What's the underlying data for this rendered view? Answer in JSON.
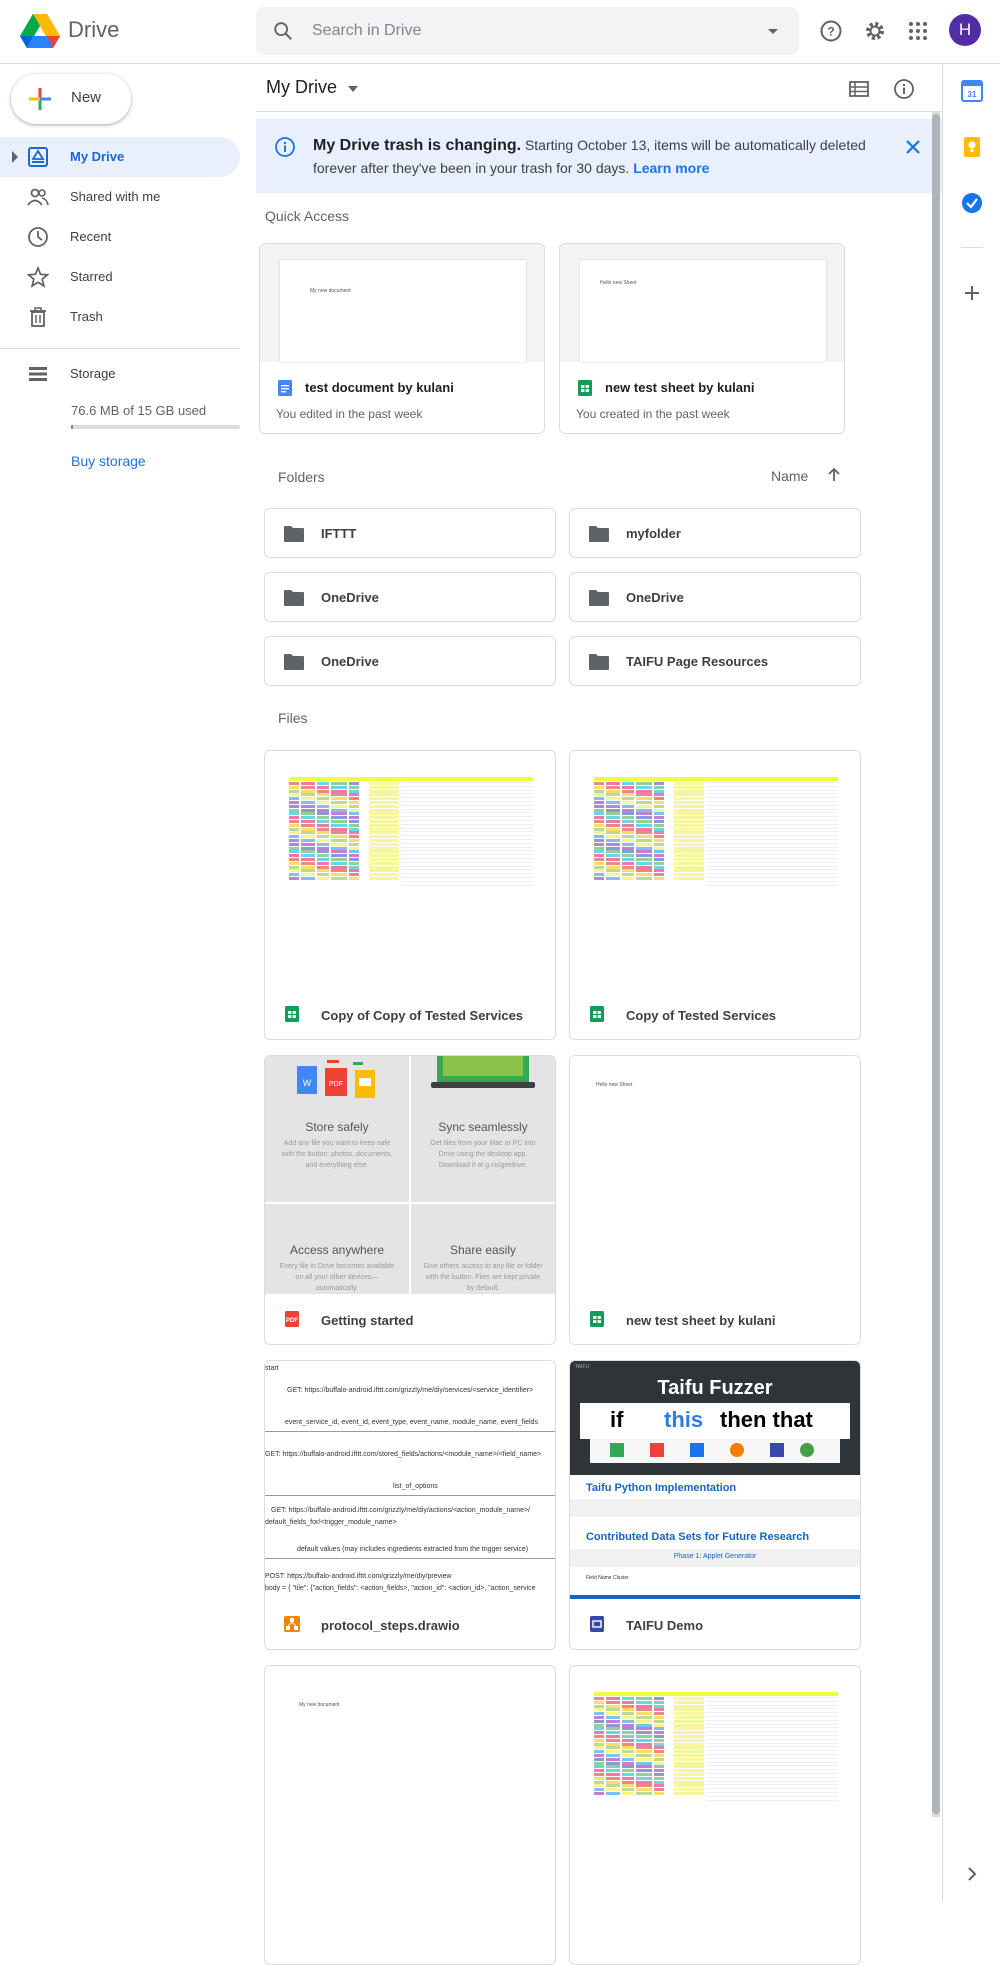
{
  "app": {
    "name": "Drive"
  },
  "search": {
    "placeholder": "Search in Drive"
  },
  "user": {
    "initial": "H"
  },
  "sidebar": {
    "new_label": "New",
    "items": [
      {
        "label": "My Drive"
      },
      {
        "label": "Shared with me"
      },
      {
        "label": "Recent"
      },
      {
        "label": "Starred"
      },
      {
        "label": "Trash"
      }
    ],
    "storage_label": "Storage",
    "storage_used": "76.6 MB of 15 GB used",
    "storage_fraction": 0.005,
    "buy_storage": "Buy storage"
  },
  "main": {
    "breadcrumb": "My Drive",
    "banner": {
      "bold": "My Drive trash is changing.",
      "text": " Starting October 13, items will be automatically deleted forever after they've been in your trash for 30 days. ",
      "link": "Learn more"
    },
    "quick_access_title": "Quick Access",
    "quick_access": [
      {
        "name": "test document by kulani",
        "sub": "You edited in the past week",
        "preview": "My new document",
        "type": "doc"
      },
      {
        "name": "new test sheet by kulani",
        "sub": "You created in the past week",
        "preview": "Hello new Sheet",
        "type": "sheet"
      }
    ],
    "folders_title": "Folders",
    "sort_label": "Name",
    "folders": [
      {
        "name": "IFTTT"
      },
      {
        "name": "myfolder"
      },
      {
        "name": "OneDrive"
      },
      {
        "name": "OneDrive"
      },
      {
        "name": "OneDrive"
      },
      {
        "name": "TAIFU Page Resources"
      }
    ],
    "files_title": "Files",
    "files": [
      {
        "name": "Copy of Copy of Tested Services",
        "type": "sheet"
      },
      {
        "name": "Copy of Tested Services",
        "type": "sheet"
      },
      {
        "name": "Getting started",
        "type": "pdf"
      },
      {
        "name": "new test sheet by kulani",
        "type": "sheet"
      },
      {
        "name": "protocol_steps.drawio",
        "type": "drawio"
      },
      {
        "name": "TAIFU Demo",
        "type": "slides"
      }
    ],
    "getting_started": {
      "tiles": [
        {
          "title": "Store safely",
          "text": "Add any file you want to keep safe with the button: photos, documents, and everything else."
        },
        {
          "title": "Sync seamlessly",
          "text": "Get files from your Mac or PC into Drive using the desktop app. Download it at g.co/getdrive."
        },
        {
          "title": "Access anywhere",
          "text": "Every file in Drive becomes available on all your other devices—automatically."
        },
        {
          "title": "Share easily",
          "text": "Give others access to any file or folder with the button. Files are kept private by default."
        }
      ]
    },
    "sheet_preview": "Hello new Sheet",
    "doc_preview": "My new document",
    "drawio_lines": [
      "GET: https://buffalo-android.ifttt.com/grizzly/me/diy/services/<service_identifier>",
      "event_service_id, event_id, event_type, event_name, module_name, event_fields",
      "GET: https://buffalo-android.ifttt.com/stored_fields/actions/<module_name>/<field_name>",
      "list_of_options",
      "GET: https://buffalo-android.ifttt.com/grizzly/me/diy/actions/<action_module_name>/",
      "default_fields_for/<trigger_module_name>",
      "default values (may includes ingredients extracted from the trigger service)",
      "POST: https://buffalo-android.ifttt.com/grizzly/me/diy/preview",
      "body = { \"tile\": {\"action_fields\": <action_fields>, \"action_id\": <action_id>, \"action_service"
    ],
    "drawio_label_start": "start",
    "taifu": {
      "tag": "TAIFU",
      "title": "Taifu Fuzzer",
      "ifttt_if": "if",
      "ifttt_this": "this",
      "ifttt_rest": "then that",
      "line1": "Taifu Python Implementation",
      "line2": "Contributed Data Sets for Future Research",
      "line3": "Phase 1: Applet Generator",
      "line4": "Field Name Cluster"
    }
  }
}
